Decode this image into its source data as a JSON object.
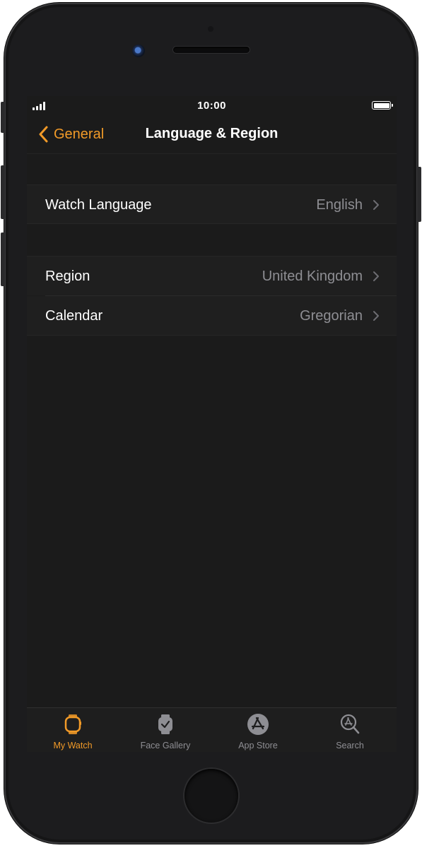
{
  "status_bar": {
    "time": "10:00"
  },
  "nav": {
    "back_label": "General",
    "title": "Language & Region"
  },
  "rows": {
    "watch_language": {
      "label": "Watch Language",
      "value": "English"
    },
    "region": {
      "label": "Region",
      "value": "United Kingdom"
    },
    "calendar": {
      "label": "Calendar",
      "value": "Gregorian"
    }
  },
  "tabbar": {
    "my_watch": "My Watch",
    "face_gallery": "Face Gallery",
    "app_store": "App Store",
    "search": "Search"
  },
  "colors": {
    "accent": "#f19a28",
    "background": "#1b1b1b",
    "secondary_text": "#8e8e93"
  },
  "icons": {
    "back": "chevron-left-icon",
    "disclosure": "chevron-right-icon",
    "my_watch": "watch-icon",
    "face_gallery": "watch-face-icon",
    "app_store": "app-store-icon",
    "search": "search-icon"
  }
}
